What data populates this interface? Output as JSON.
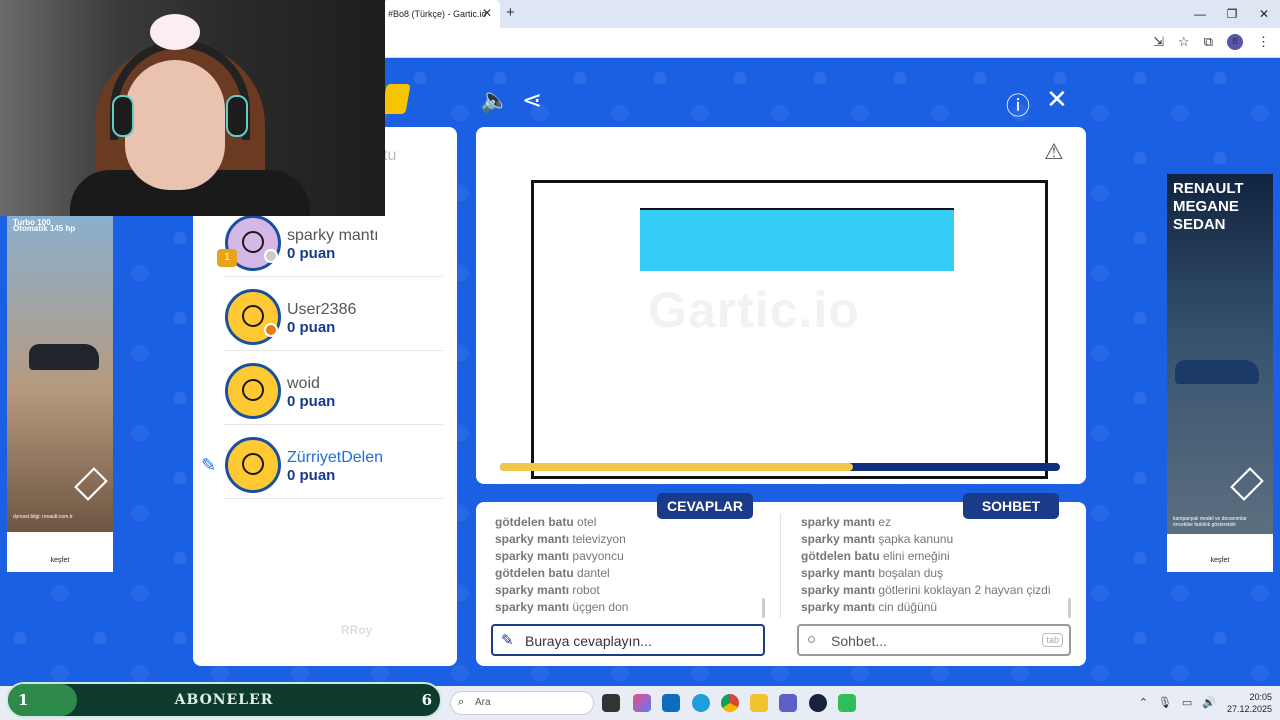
{
  "browser": {
    "tab_title": "#Bo8 (Türkçe) - Gartic.io",
    "tab_close": "✕",
    "new_tab": "+",
    "window_buttons": [
      "—",
      "❐",
      "✕"
    ],
    "profile_initial": "B"
  },
  "panel": {
    "header_fragment": "tu"
  },
  "players": [
    {
      "name": "sparky mantı",
      "score": "0 puan",
      "avatar": "purple",
      "badge_color": "#cccccc",
      "trophy": true
    },
    {
      "name": "User2386",
      "score": "0 puan",
      "avatar": "yellow",
      "badge_color": "#e87a12",
      "trophy": false
    },
    {
      "name": "woid",
      "score": "0 puan",
      "avatar": "yellow",
      "badge_color": "",
      "trophy": false
    },
    {
      "name": "ZürriyetDelen",
      "score": "0 puan",
      "avatar": "yellow",
      "badge_color": "",
      "trophy": false,
      "drawing": true
    }
  ],
  "trophy_label": "1",
  "watermark_user": "RRoy",
  "canvas": {
    "watermark": "Gartic.io",
    "timer_progress": 0.63,
    "fill_color": "#35cdf8"
  },
  "answers": {
    "tab_label": "CEVAPLAR",
    "placeholder": "Buraya cevaplayın...",
    "messages": [
      {
        "who": "götdelen batu",
        "text": "otel"
      },
      {
        "who": "sparky mantı",
        "text": "televizyon"
      },
      {
        "who": "sparky mantı",
        "text": "pavyoncu"
      },
      {
        "who": "götdelen batu",
        "text": "dantel"
      },
      {
        "who": "sparky mantı",
        "text": "robot"
      },
      {
        "who": "sparky mantı",
        "text": "üçgen don"
      }
    ]
  },
  "chat": {
    "tab_label": "SOHBET",
    "placeholder": "Sohbet...",
    "tab_key": "tab",
    "messages": [
      {
        "who": "sparky mantı",
        "text": "ez"
      },
      {
        "who": "sparky mantı",
        "text": "şapka kanunu"
      },
      {
        "who": "götdelen batu",
        "text": "elini emeğini"
      },
      {
        "who": "sparky mantı",
        "text": "boşalan duş"
      },
      {
        "who": "sparky mantı",
        "text": "götlerini koklayan 2 hayvan çizdi"
      },
      {
        "who": "sparky mantı",
        "text": "cin düğünü"
      }
    ]
  },
  "ads": {
    "left": {
      "headline": "Turbo 100",
      "sub": "Otomatik 145 hp",
      "cta": "keşfet",
      "url": "dyresel.bilgi: renault.com.tr"
    },
    "right": {
      "headline": "RENAULT MEGANE SEDAN",
      "cta": "keşfet",
      "disclaimer": "kampanyalı model ve donanımlar öncekiler farklılık gösterebilir"
    }
  },
  "subscribers": {
    "current": "1",
    "label": "ABONELER",
    "goal": "6",
    "progress": 0.16
  },
  "taskbar": {
    "search_placeholder": "Ara",
    "time": "20:05",
    "date": "27.12.2025"
  }
}
